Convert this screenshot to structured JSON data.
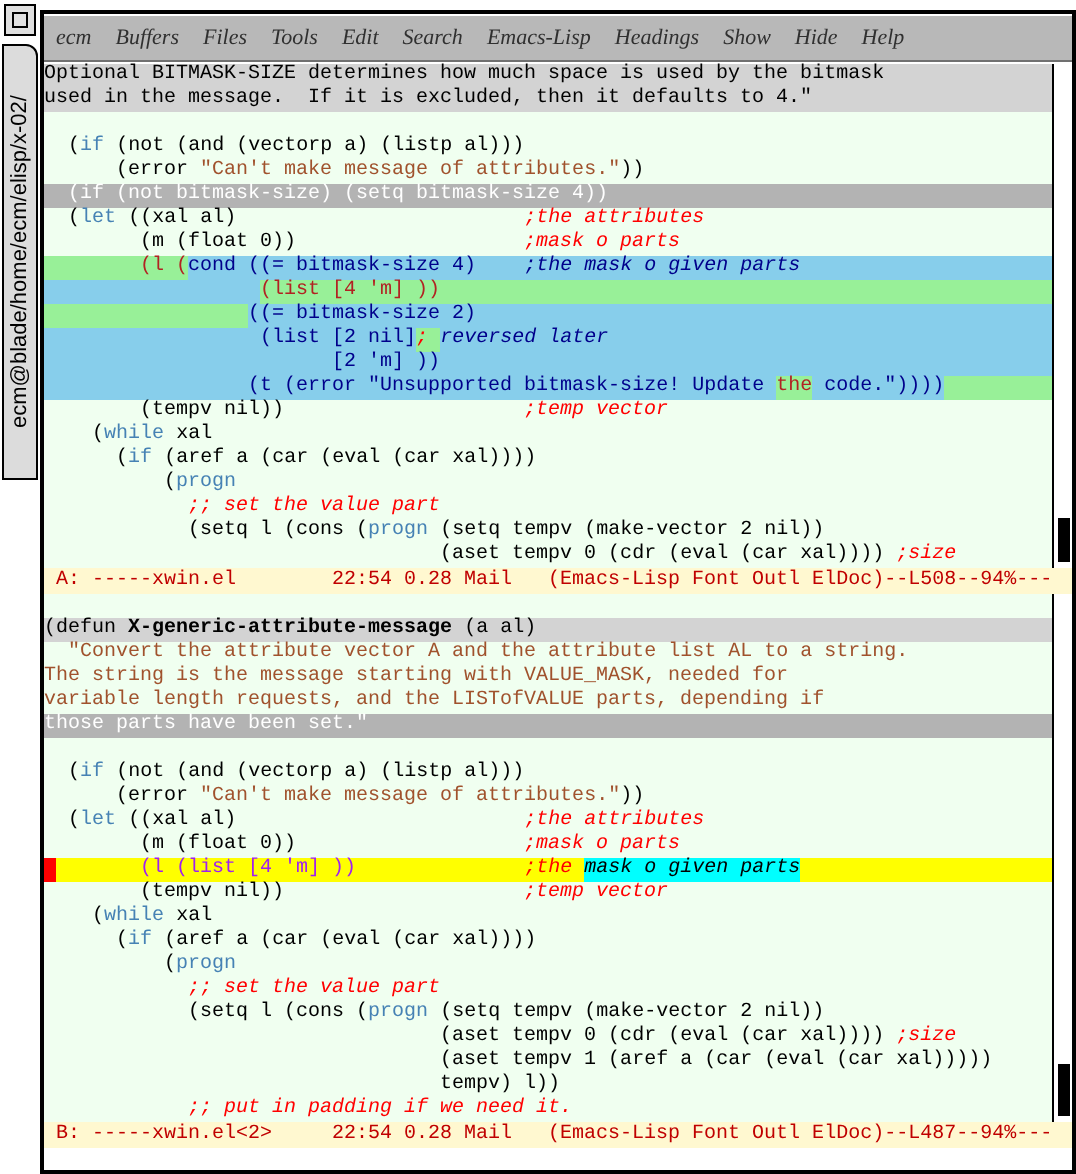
{
  "window": {
    "title": "ecm@blade/home/ecm/elisp/x-02/"
  },
  "menu": [
    "ecm",
    "Buffers",
    "Files",
    "Tools",
    "Edit",
    "Search",
    "Emacs-Lisp",
    "Headings",
    "Show",
    "Hide",
    "Help"
  ],
  "panes": [
    {
      "lines": [
        {
          "color": "#d3d3d3",
          "segments": [
            {
              "text": "Optional BITMASK-SIZE determines how much space is used by the bitmask",
              "kind": "code"
            }
          ]
        },
        {
          "color": "#d3d3d3",
          "segments": [
            {
              "text": "used in the message.  If it is excluded, then it defaults to 4.\"",
              "kind": "code"
            }
          ]
        },
        {
          "blank": true
        },
        {
          "segments": [
            {
              "text": "  (",
              "kind": "code"
            },
            {
              "text": "if",
              "kind": "keyword"
            },
            {
              "text": " (not (and (vectorp a) (listp al)))",
              "kind": "code"
            }
          ]
        },
        {
          "segments": [
            {
              "text": "      (error ",
              "kind": "code"
            },
            {
              "text": "\"Can't make message of attributes.\"",
              "kind": "string"
            },
            {
              "text": "))",
              "kind": "code"
            }
          ]
        },
        {
          "color": "#b3b3b3",
          "segments": [
            {
              "text": "  (if (not bitmask-size) (setq bitmask-size 4))",
              "kind": "dim"
            }
          ]
        },
        {
          "segments": [
            {
              "text": "  (",
              "kind": "code"
            },
            {
              "text": "let",
              "kind": "keyword"
            },
            {
              "text": " ((xal al)                        ",
              "kind": "code"
            },
            {
              "text": ";the attributes",
              "kind": "comment"
            }
          ]
        },
        {
          "segments": [
            {
              "text": "        (m (float 0))                   ",
              "kind": "code"
            },
            {
              "text": ";mask o parts",
              "kind": "comment"
            }
          ]
        },
        {
          "regions": [
            {
              "color": "#98f098",
              "segments": [
                {
                  "text": "        (l (",
                  "kind": "warn"
                }
              ]
            },
            {
              "color": "#87ceeb",
              "segments": [
                {
                  "text": "cond ((= bitmask-size 4)    ",
                  "kind": "navy"
                },
                {
                  "text": ";the mask o given parts",
                  "kind": "comment2"
                }
              ]
            }
          ]
        },
        {
          "regions": [
            {
              "color": "#87ceeb"
            },
            {
              "color": "#98f098",
              "segments": [
                {
                  "text": "                  (list [4 'm] ))",
                  "kind": "warn"
                }
              ]
            }
          ]
        },
        {
          "regions": [
            {
              "color": "#98f098"
            },
            {
              "color": "#87ceeb",
              "segments": [
                {
                  "text": "                 ((= bitmask-size 2)",
                  "kind": "navy"
                }
              ]
            }
          ]
        },
        {
          "color": "#87ceeb",
          "segments": [
            {
              "text": "                  (list [2 nil]",
              "kind": "navy"
            },
            {
              "text": "; ",
              "kind": "comment",
              "color": "#98f098"
            },
            {
              "text": "reversed later",
              "kind": "comment2"
            }
          ]
        },
        {
          "color": "#87ceeb",
          "segments": [
            {
              "text": "                        [2 'm] ))",
              "kind": "navy"
            }
          ]
        },
        {
          "regions": [
            {
              "color": "#87ceeb",
              "segments": [
                {
                  "text": "                 (t (error \"Unsupported bitmask-size! Update ",
                  "kind": "navy"
                }
              ]
            },
            {
              "color": "#98f098",
              "segments": [
                {
                  "text": "the",
                  "kind": "warn"
                }
              ]
            },
            {
              "color": "#87ceeb",
              "segments": [
                {
                  "text": " code.\"))))",
                  "kind": "navy"
                }
              ]
            },
            {
              "color": "#98f098"
            }
          ]
        },
        {
          "segments": [
            {
              "text": "        (tempv nil))                    ",
              "kind": "code"
            },
            {
              "text": ";temp vector",
              "kind": "comment"
            }
          ]
        },
        {
          "segments": [
            {
              "text": "    (",
              "kind": "code"
            },
            {
              "text": "while",
              "kind": "keyword"
            },
            {
              "text": " xal",
              "kind": "code"
            }
          ]
        },
        {
          "segments": [
            {
              "text": "      (",
              "kind": "code"
            },
            {
              "text": "if",
              "kind": "keyword"
            },
            {
              "text": " (aref a (car (eval (car xal))))",
              "kind": "code"
            }
          ]
        },
        {
          "segments": [
            {
              "text": "          (",
              "kind": "code"
            },
            {
              "text": "progn",
              "kind": "keyword"
            }
          ]
        },
        {
          "segments": [
            {
              "text": "            ;; set the value part",
              "kind": "comment"
            }
          ]
        },
        {
          "segments": [
            {
              "text": "            (setq l (cons (",
              "kind": "code"
            },
            {
              "text": "progn",
              "kind": "keyword"
            },
            {
              "text": " (setq tempv (make-vector 2 nil))",
              "kind": "code"
            }
          ]
        },
        {
          "segments": [
            {
              "text": "                                 (aset tempv 0 (cdr (eval (car xal)))) ",
              "kind": "code"
            },
            {
              "text": ";size",
              "kind": "comment"
            }
          ]
        }
      ],
      "mode_line": "A: -----xwin.el        22:54 0.28 Mail   (Emacs-Lisp Font Outl ElDoc)--L508--94%---"
    },
    {
      "lines": [
        {
          "blank": true
        },
        {
          "color": "#d3d3d3",
          "segments": [
            {
              "text": "(defun ",
              "kind": "code"
            },
            {
              "text": "X-generic-attribute-message",
              "kind": "fname"
            },
            {
              "text": " (a al)",
              "kind": "code"
            }
          ]
        },
        {
          "segments": [
            {
              "text": "  \"Convert the attribute vector A and the attribute list AL to a string.",
              "kind": "doc"
            }
          ]
        },
        {
          "segments": [
            {
              "text": "The string is the message starting with VALUE_MASK, needed for",
              "kind": "doc"
            }
          ]
        },
        {
          "segments": [
            {
              "text": "variable length requests, and the LISTofVALUE parts, depending if",
              "kind": "doc"
            }
          ]
        },
        {
          "color": "#b3b3b3",
          "segments": [
            {
              "text": "those parts have been set.\"",
              "kind": "dim"
            }
          ]
        },
        {
          "blank": true
        },
        {
          "segments": [
            {
              "text": "  (",
              "kind": "code"
            },
            {
              "text": "if",
              "kind": "keyword"
            },
            {
              "text": " (not (and (vectorp a) (listp al)))",
              "kind": "code"
            }
          ]
        },
        {
          "segments": [
            {
              "text": "      (error ",
              "kind": "code"
            },
            {
              "text": "\"Can't make message of attributes.\"",
              "kind": "string"
            },
            {
              "text": "))",
              "kind": "code"
            }
          ]
        },
        {
          "segments": [
            {
              "text": "  (",
              "kind": "code"
            },
            {
              "text": "let",
              "kind": "keyword"
            },
            {
              "text": " ((xal al)                        ",
              "kind": "code"
            },
            {
              "text": ";the attributes",
              "kind": "comment"
            }
          ]
        },
        {
          "segments": [
            {
              "text": "        (m (float 0))                   ",
              "kind": "code"
            },
            {
              "text": ";mask o parts",
              "kind": "comment"
            }
          ]
        },
        {
          "color": "#ffff00",
          "segments": [
            {
              "text": "        (l (list [4 'm] ))              ",
              "kind": "purple",
              "cursor": true
            },
            {
              "text": ";the ",
              "kind": "comment"
            },
            {
              "text": "mask o given parts",
              "kind": "commenthl",
              "color": "#00ffff"
            }
          ]
        },
        {
          "segments": [
            {
              "text": "        (tempv nil))                    ",
              "kind": "code"
            },
            {
              "text": ";temp vector",
              "kind": "comment"
            }
          ]
        },
        {
          "segments": [
            {
              "text": "    (",
              "kind": "code"
            },
            {
              "text": "while",
              "kind": "keyword"
            },
            {
              "text": " xal",
              "kind": "code"
            }
          ]
        },
        {
          "segments": [
            {
              "text": "      (",
              "kind": "code"
            },
            {
              "text": "if",
              "kind": "keyword"
            },
            {
              "text": " (aref a (car (eval (car xal))))",
              "kind": "code"
            }
          ]
        },
        {
          "segments": [
            {
              "text": "          (",
              "kind": "code"
            },
            {
              "text": "progn",
              "kind": "keyword"
            }
          ]
        },
        {
          "segments": [
            {
              "text": "            ;; set the value part",
              "kind": "comment"
            }
          ]
        },
        {
          "segments": [
            {
              "text": "            (setq l (cons (",
              "kind": "code"
            },
            {
              "text": "progn",
              "kind": "keyword"
            },
            {
              "text": " (setq tempv (make-vector 2 nil))",
              "kind": "code"
            }
          ]
        },
        {
          "segments": [
            {
              "text": "                                 (aset tempv 0 (cdr (eval (car xal)))) ",
              "kind": "code"
            },
            {
              "text": ";size",
              "kind": "comment"
            }
          ]
        },
        {
          "segments": [
            {
              "text": "                                 (aset tempv 1 (aref a (car (eval (car xal)))))",
              "kind": "code"
            }
          ]
        },
        {
          "segments": [
            {
              "text": "                                 tempv) l))",
              "kind": "code"
            }
          ]
        },
        {
          "segments": [
            {
              "text": "            ;; put in padding if we need it.",
              "kind": "comment"
            }
          ]
        }
      ],
      "mode_line": "B: -----xwin.el<2>     22:54 0.28 Mail   (Emacs-Lisp Font Outl ElDoc)--L487--94%---"
    }
  ]
}
